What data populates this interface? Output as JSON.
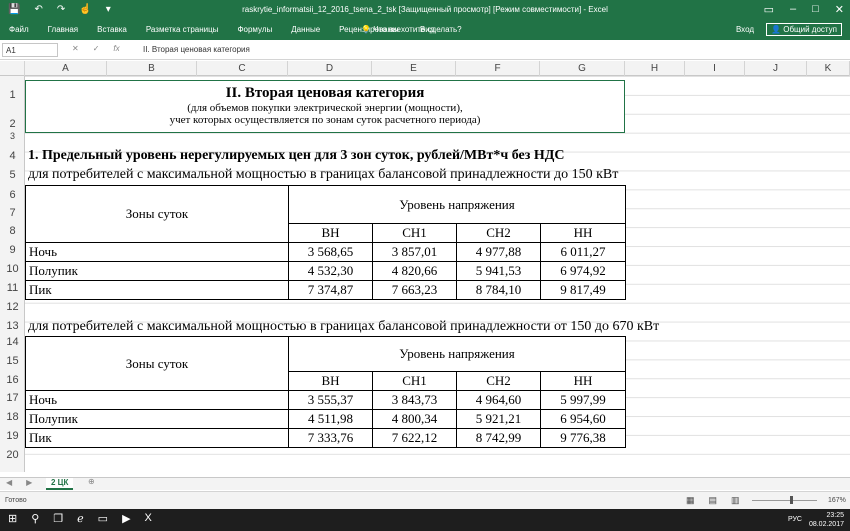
{
  "window": {
    "title": "raskrytie_informatsii_12_2016_tsena_2_tsk [Защищенный просмотр] [Режим совместимости] - Excel"
  },
  "ribbon": {
    "tabs": [
      "Файл",
      "Главная",
      "Вставка",
      "Разметка страницы",
      "Формулы",
      "Данные",
      "Рецензирование",
      "Вид"
    ],
    "tell_me": "Что вы хотите сделать?",
    "signin": "Вход",
    "share": "Общий доступ"
  },
  "formula_bar": {
    "name_box": "A1",
    "formula": "II. Вторая ценовая категория"
  },
  "columns": [
    "A",
    "B",
    "C",
    "D",
    "E",
    "F",
    "G",
    "H",
    "I",
    "J",
    "K"
  ],
  "rows": [
    "1",
    "2",
    "3",
    "4",
    "5",
    "6",
    "7",
    "8",
    "9",
    "10",
    "11",
    "12",
    "13",
    "14",
    "15",
    "16",
    "17",
    "18",
    "19",
    "20"
  ],
  "sheet": {
    "title": "II. Вторая ценовая категория",
    "subtitle1": "(для объемов покупки электрической энергии (мощности),",
    "subtitle2": "учет которых осуществляется по зонам суток расчетного периода)",
    "section1": "1. Предельный уровень нерегулируемых цен для 3 зон суток, рублей/МВт*ч без НДС",
    "t1_caption": "для потребителей с максимальной мощностью в границах балансовой принадлежности до 150 кВт",
    "t2_caption": "для потребителей с максимальной мощностью в границах балансовой принадлежности от 150 до 670 кВт",
    "zones_header": "Зоны суток",
    "voltage_header": "Уровень напряжения",
    "voltage_levels": [
      "ВН",
      "СН1",
      "СН2",
      "НН"
    ],
    "table1": [
      {
        "zone": "Ночь",
        "values": [
          "3 568,65",
          "3 857,01",
          "4 977,88",
          "6 011,27"
        ]
      },
      {
        "zone": "Полупик",
        "values": [
          "4 532,30",
          "4 820,66",
          "5 941,53",
          "6 974,92"
        ]
      },
      {
        "zone": "Пик",
        "values": [
          "7 374,87",
          "7 663,23",
          "8 784,10",
          "9 817,49"
        ]
      }
    ],
    "table2": [
      {
        "zone": "Ночь",
        "values": [
          "3 555,37",
          "3 843,73",
          "4 964,60",
          "5 997,99"
        ]
      },
      {
        "zone": "Полупик",
        "values": [
          "4 511,98",
          "4 800,34",
          "5 921,21",
          "6 954,60"
        ]
      },
      {
        "zone": "Пик",
        "values": [
          "7 333,76",
          "7 622,12",
          "8 742,99",
          "9 776,38"
        ]
      }
    ]
  },
  "sheet_tab": "2 ЦК",
  "status": {
    "ready": "Готово",
    "zoom": "167%"
  },
  "taskbar": {
    "lang": "РУС",
    "time": "23:25",
    "date": "08.02.2017"
  }
}
